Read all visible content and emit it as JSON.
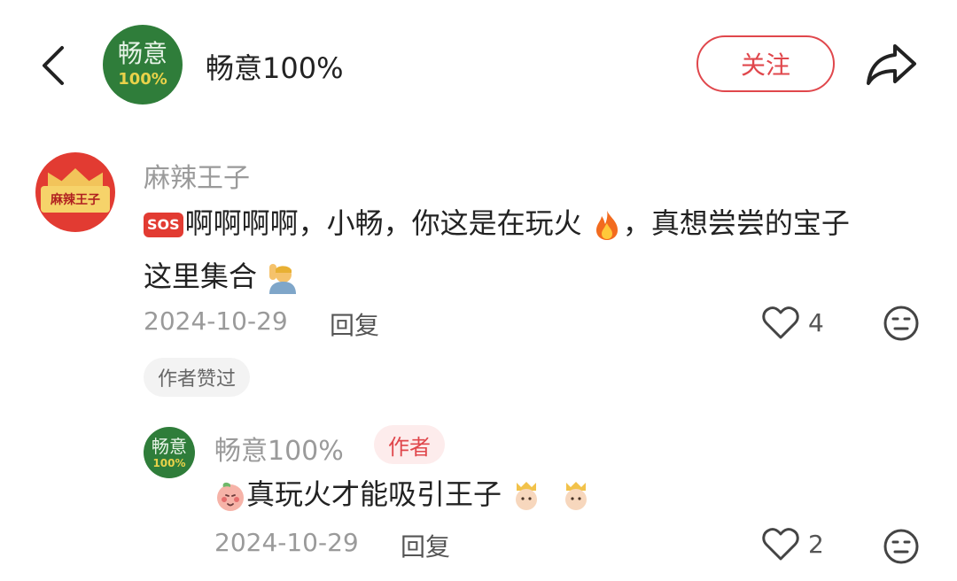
{
  "header": {
    "account_name": "畅意100%",
    "logo_line1": "畅意",
    "logo_line2": "100%",
    "follow_label": "关注"
  },
  "comments": [
    {
      "user": "麻辣王子",
      "avatar_text": "麻辣王子",
      "text_part1": "啊啊啊啊，小畅，你这是在玩火",
      "text_part2": "，真想尝尝的宝子",
      "text_part3": "这里集合",
      "sos_label": "SOS",
      "date": "2024-10-29",
      "reply_label": "回复",
      "likes": "4",
      "badge": "作者赞过",
      "reply": {
        "user": "畅意100%",
        "author_tag": "作者",
        "text": "真玩火才能吸引王子",
        "date": "2024-10-29",
        "reply_label": "回复",
        "likes": "2"
      }
    }
  ],
  "icons": {
    "back": "chevron-left-icon",
    "share": "share-arrow-icon",
    "like": "heart-outline-icon",
    "dislike": "meh-face-icon"
  },
  "colors": {
    "accent": "#e0474c",
    "brand_green": "#2f7d3a",
    "muted_text": "#9a9a9a",
    "badge_bg": "#f3f3f3"
  }
}
